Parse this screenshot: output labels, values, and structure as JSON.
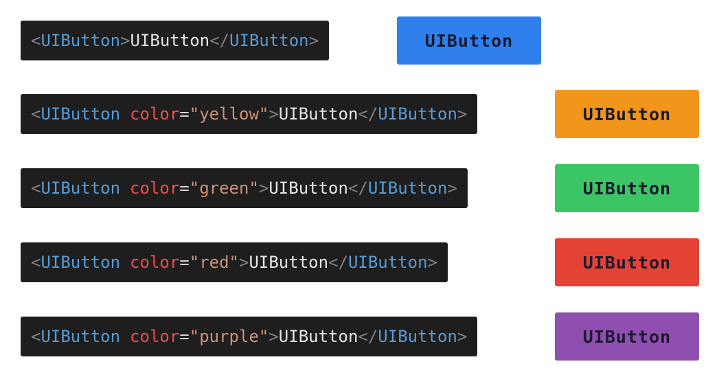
{
  "examples": [
    {
      "code": {
        "open_lt": "<",
        "tag": "UIButton",
        "attr": "",
        "eq": "",
        "val": "",
        "open_gt": ">",
        "content": "UIButton",
        "close_lt": "</",
        "close_tag": "UIButton",
        "close_gt": ">"
      },
      "button": {
        "label": "UIButton",
        "color": "#2f80ed"
      }
    },
    {
      "code": {
        "open_lt": "<",
        "tag": "UIButton",
        "attr": "color",
        "eq": "=",
        "val": "\"yellow\"",
        "open_gt": ">",
        "content": "UIButton",
        "close_lt": "</",
        "close_tag": "UIButton",
        "close_gt": ">"
      },
      "button": {
        "label": "UIButton",
        "color": "#f2951b"
      }
    },
    {
      "code": {
        "open_lt": "<",
        "tag": "UIButton",
        "attr": "color",
        "eq": "=",
        "val": "\"green\"",
        "open_gt": ">",
        "content": "UIButton",
        "close_lt": "</",
        "close_tag": "UIButton",
        "close_gt": ">"
      },
      "button": {
        "label": "UIButton",
        "color": "#3cc565"
      }
    },
    {
      "code": {
        "open_lt": "<",
        "tag": "UIButton",
        "attr": "color",
        "eq": "=",
        "val": "\"red\"",
        "open_gt": ">",
        "content": "UIButton",
        "close_lt": "</",
        "close_tag": "UIButton",
        "close_gt": ">"
      },
      "button": {
        "label": "UIButton",
        "color": "#e44235"
      }
    },
    {
      "code": {
        "open_lt": "<",
        "tag": "UIButton",
        "attr": "color",
        "eq": "=",
        "val": "\"purple\"",
        "open_gt": ">",
        "content": "UIButton",
        "close_lt": "</",
        "close_tag": "UIButton",
        "close_gt": ">"
      },
      "button": {
        "label": "UIButton",
        "color": "#8e4fb0"
      }
    }
  ]
}
